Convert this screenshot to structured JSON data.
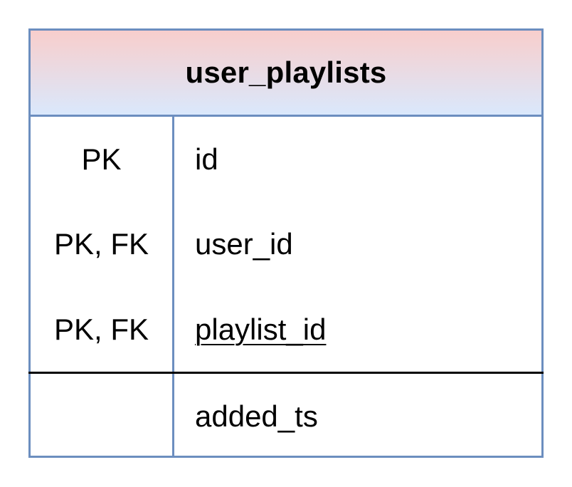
{
  "entity": {
    "title": "user_playlists",
    "rows": [
      {
        "key": "PK",
        "field": "id",
        "underlined": false
      },
      {
        "key": "PK, FK",
        "field": "user_id",
        "underlined": false
      },
      {
        "key": "PK, FK",
        "field": "playlist_id",
        "underlined": true
      },
      {
        "key": "",
        "field": "added_ts",
        "underlined": false
      }
    ]
  },
  "colors": {
    "border": "#6c8ebf",
    "header_gradient_top": "#f8cecc",
    "header_gradient_bottom": "#dae8fc",
    "separator": "#000000"
  }
}
